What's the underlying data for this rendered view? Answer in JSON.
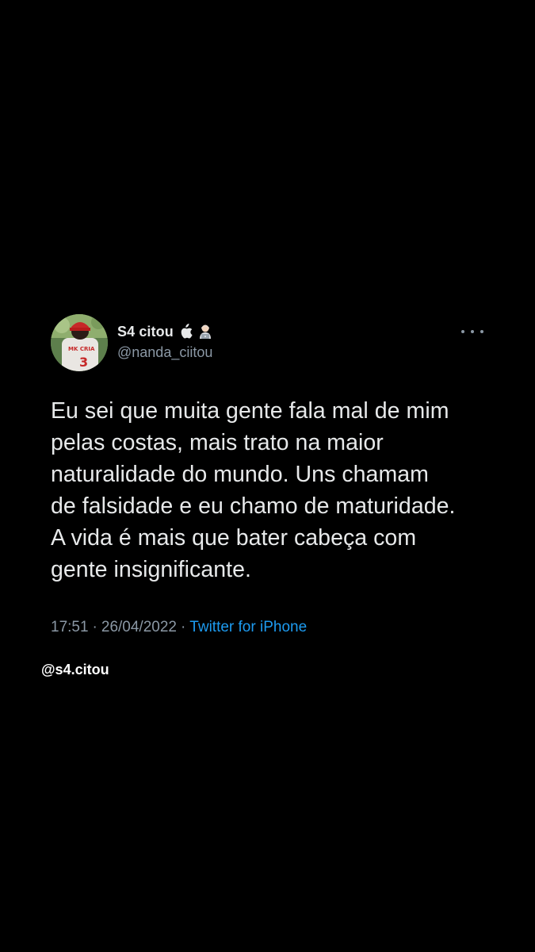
{
  "tweet": {
    "display_name": "S4 citou",
    "badges": [
      "apple-icon",
      "person-technologist-icon"
    ],
    "handle": "@nanda_ciitou",
    "text": "Eu sei que muita gente fala mal de mim\npelas costas, mais trato na maior\nnaturalidade do mundo. Uns chamam\nde falsidade e eu chamo de maturidade.\nA vida é mais que bater cabeça com\ngente insignificante.",
    "time": "17:51",
    "separator1": "·",
    "date": "26/04/2022",
    "separator2": "·",
    "source": "Twitter for iPhone"
  },
  "watermark": "@s4.citou",
  "colors": {
    "background": "#000000",
    "primary_text": "#e7e9ea",
    "secondary_text": "#8b98a5",
    "link": "#1d9bf0"
  }
}
